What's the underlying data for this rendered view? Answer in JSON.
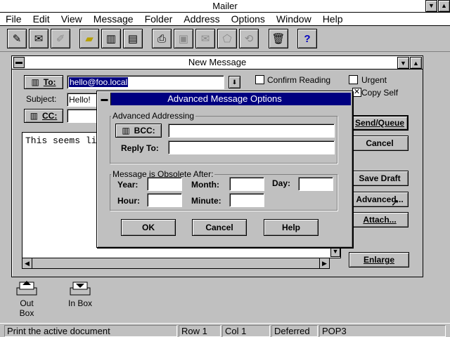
{
  "app": {
    "title": "Mailer"
  },
  "menu": [
    "File",
    "Edit",
    "View",
    "Message",
    "Folder",
    "Address",
    "Options",
    "Window",
    "Help"
  ],
  "compose": {
    "title": "New Message",
    "to_label": "To:",
    "to_value": "hello@foo.local",
    "subject_label": "Subject:",
    "subject_value": "Hello!",
    "cc_label": "CC:",
    "body": "This seems li",
    "confirm_reading": "Confirm Reading",
    "urgent": "Urgent",
    "copy_self": "Copy Self",
    "send_queue": "Send/Queue",
    "cancel": "Cancel",
    "save_draft": "Save Draft",
    "advanced": "Advanced...",
    "attach": "Attach...",
    "enlarge": "Enlarge"
  },
  "dialog": {
    "title": "Advanced Message Options",
    "group_addressing": "Advanced Addressing",
    "bcc_label": "BCC:",
    "reply_to_label": "Reply To:",
    "group_obsolete": "Message is Obsolete After:",
    "year": "Year:",
    "month": "Month:",
    "day": "Day:",
    "hour": "Hour:",
    "minute": "Minute:",
    "ok": "OK",
    "cancel": "Cancel",
    "help": "Help"
  },
  "desktop": {
    "outbox": "Out Box",
    "inbox": "In Box"
  },
  "status": {
    "message": "Print the active document",
    "row": "Row 1",
    "col": "Col  1",
    "mode": "Deferred",
    "protocol": "POP3"
  },
  "colors": {
    "dialog_title": "#000080",
    "selection": "#000080"
  }
}
